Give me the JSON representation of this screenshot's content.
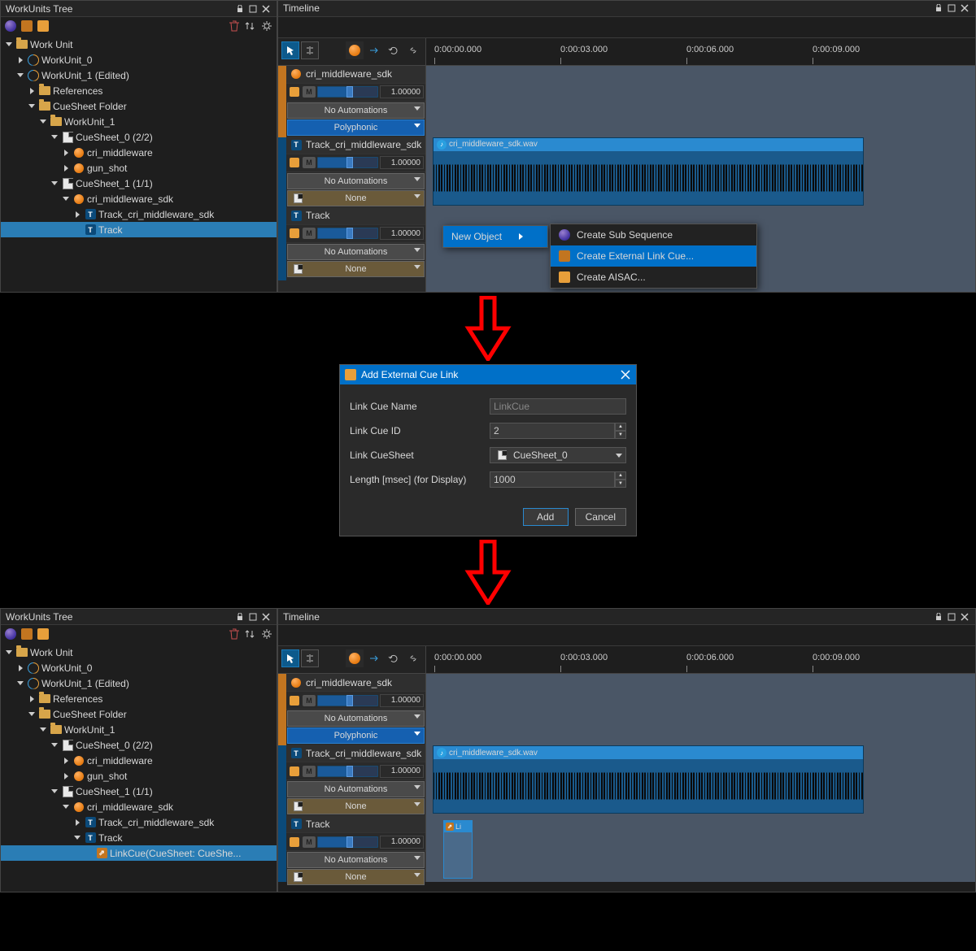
{
  "panels": {
    "tree_title": "WorkUnits Tree",
    "tl_title": "Timeline"
  },
  "tree1": {
    "root": "Work Unit",
    "wu0": "WorkUnit_0",
    "wu1": "WorkUnit_1 (Edited)",
    "refs": "References",
    "csfolder": "CueSheet Folder",
    "wu1b": "WorkUnit_1",
    "cs0": "CueSheet_0 (2/2)",
    "cue_a": "cri_middleware",
    "cue_b": "gun_shot",
    "cs1": "CueSheet_1 (1/1)",
    "cue_sdk": "cri_middleware_sdk",
    "trk_sdk": "Track_cri_middleware_sdk",
    "trk": "Track"
  },
  "tree2_extra": {
    "link_cue_item": "LinkCue(CueSheet: CueShe..."
  },
  "tracks": {
    "cue_name": "cri_middleware_sdk",
    "vol": "1.00000",
    "noauto": "No Automations",
    "poly": "Polyphonic",
    "t1": "Track_cri_middleware_sdk",
    "none": "None",
    "t2": "Track"
  },
  "ruler": [
    "0:00:00.000",
    "0:00:03.000",
    "0:00:06.000",
    "0:00:09.000"
  ],
  "clip_name": "cri_middleware_sdk.wav",
  "ctx": {
    "parent": "New Object",
    "sub1": "Create Sub Sequence",
    "sub2": "Create External Link Cue...",
    "sub3": "Create AISAC..."
  },
  "dialog": {
    "title": "Add External Cue Link",
    "f_name_l": "Link Cue Name",
    "f_name_v": "LinkCue",
    "f_id_l": "Link Cue ID",
    "f_id_v": "2",
    "f_cs_l": "Link CueSheet",
    "f_cs_v": "CueSheet_0",
    "f_len_l": "Length [msec] (for Display)",
    "f_len_v": "1000",
    "add": "Add",
    "cancel": "Cancel"
  },
  "link_clip": "Li"
}
